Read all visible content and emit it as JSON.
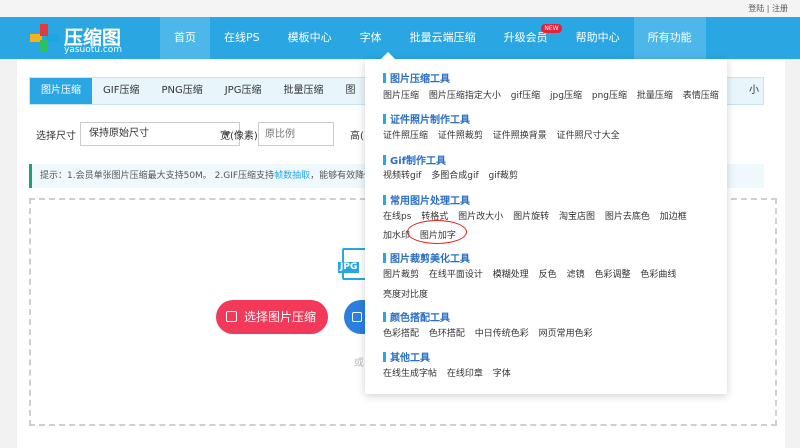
{
  "topbar": {
    "login": "登陆",
    "sep": "|",
    "register": "注册"
  },
  "logo": {
    "name": "压缩图",
    "domain": "yasuotu.com"
  },
  "nav": {
    "items": [
      {
        "label": "首页"
      },
      {
        "label": "在线PS"
      },
      {
        "label": "模板中心"
      },
      {
        "label": "字体"
      },
      {
        "label": "批量云端压缩"
      },
      {
        "label": "升级会员",
        "badge": "NEW"
      },
      {
        "label": "帮助中心"
      },
      {
        "label": "所有功能"
      }
    ]
  },
  "tabs": {
    "items": [
      "图片压缩",
      "GIF压缩",
      "PNG压缩",
      "JPG压缩",
      "批量压缩",
      "图"
    ],
    "tail": "小"
  },
  "filter": {
    "size_label": "选择尺寸",
    "size_value": "保持原始尺寸",
    "width_label": "宽(像素)",
    "width_placeholder": "原比例",
    "height_label": "高("
  },
  "tip": {
    "text": "提示：1.会员单张图片压缩最大支持50M。 2.GIF压缩支持",
    "link": "帧数抽取",
    "tail": "，能够有效降低"
  },
  "upload": {
    "file_tag": "JPG",
    "select_button": "选择图片压缩",
    "or": "或"
  },
  "menu": {
    "sections": [
      {
        "title": "图片压缩工具",
        "items": [
          "图片压缩",
          "图片压缩指定大小",
          "gif压缩",
          "jpg压缩",
          "png压缩",
          "批量压缩",
          "表情压缩"
        ]
      },
      {
        "title": "证件照片制作工具",
        "items": [
          "证件照压缩",
          "证件照裁剪",
          "证件照换背景",
          "证件照尺寸大全"
        ]
      },
      {
        "title": "Gif制作工具",
        "items": [
          "视频转gif",
          "多图合成gif",
          "gif裁剪"
        ]
      },
      {
        "title": "常用图片处理工具",
        "items": [
          "在线ps",
          "转格式",
          "图片改大小",
          "图片旋转",
          "淘宝店图",
          "图片去底色",
          "加边框"
        ],
        "items2": [
          "加水印",
          "图片加字"
        ]
      },
      {
        "title": "图片裁剪美化工具",
        "items": [
          "图片裁剪",
          "在线平面设计",
          "模糊处理",
          "反色",
          "滤镜",
          "色彩调整",
          "色彩曲线"
        ],
        "items2": [
          "亮度对比度"
        ]
      },
      {
        "title": "颜色搭配工具",
        "items": [
          "色彩搭配",
          "色环搭配",
          "中日传统色彩",
          "网页常用色彩"
        ]
      },
      {
        "title": "其他工具",
        "items": [
          "在线生成字帖",
          "在线印章",
          "字体"
        ]
      }
    ]
  },
  "colors": {
    "brand": "#2aa7e2",
    "accent": "#f2395a",
    "highlight": "#e02020"
  }
}
